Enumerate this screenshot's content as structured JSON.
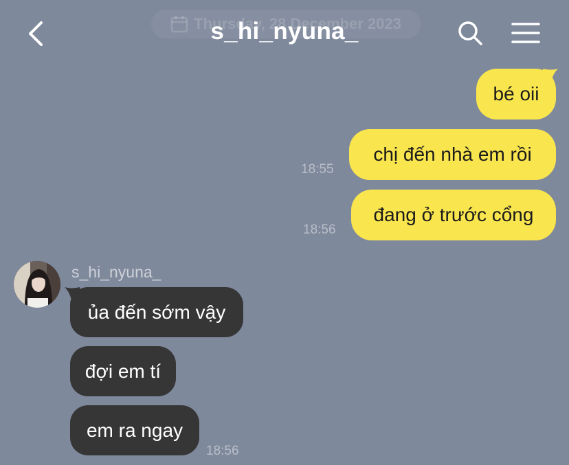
{
  "header": {
    "date_label": "Thursday, 28 December 2023",
    "title": "s_hi_nyuna_",
    "icons": [
      "chevron-left-icon",
      "calendar-icon",
      "search-icon",
      "hamburger-menu-icon"
    ]
  },
  "colors": {
    "background": "#7f899c",
    "outgoing_bubble": "#f9e54e",
    "incoming_bubble": "#363636"
  },
  "messages_outgoing": [
    {
      "text": "bé oii",
      "time": ""
    },
    {
      "text": "chị đến nhà em rồi",
      "time": "18:55"
    },
    {
      "text": "đang ở trước cổng",
      "time": "18:56"
    }
  ],
  "incoming": {
    "sender": "s_hi_nyuna_",
    "messages": [
      {
        "text": "ủa đến sớm vậy",
        "time": ""
      },
      {
        "text": "đợi em tí",
        "time": ""
      },
      {
        "text": "em ra ngay",
        "time": "18:56"
      }
    ]
  }
}
